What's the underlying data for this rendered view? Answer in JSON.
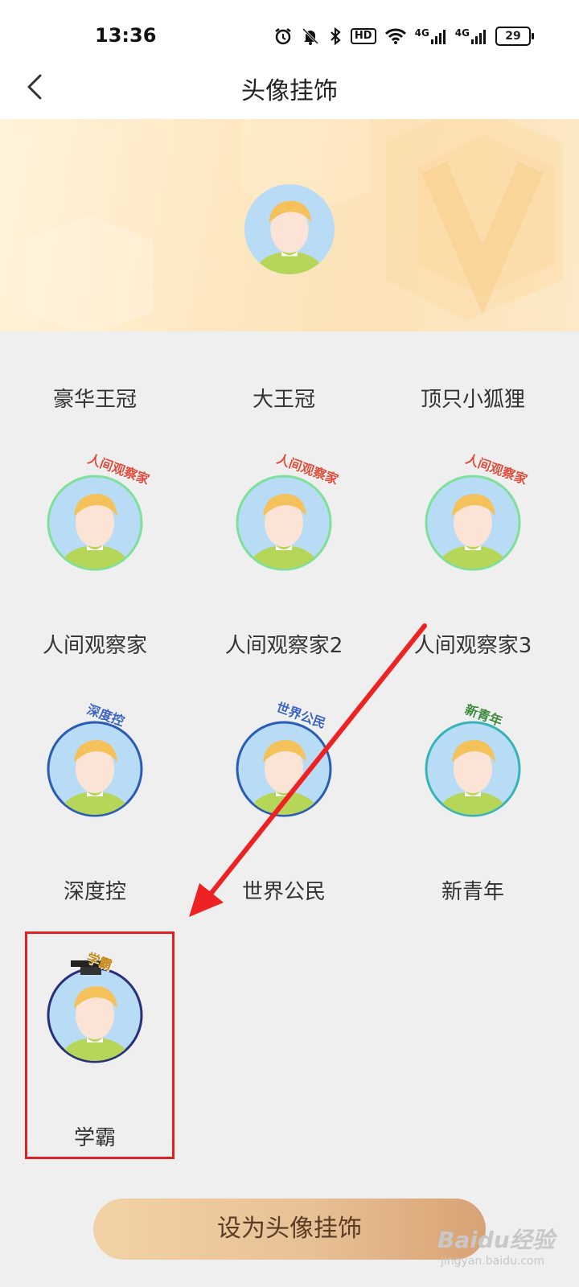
{
  "status": {
    "time": "13:36",
    "battery": "29",
    "network1": "4G",
    "network2": "4G",
    "hd": "HD"
  },
  "header": {
    "title": "头像挂饰",
    "back_icon": "chevron-left-icon"
  },
  "row0_labels": [
    "豪华王冠",
    "大王冠",
    "顶只小狐狸"
  ],
  "grid": [
    {
      "label": "人间观察家",
      "badge_text": "人间观察家"
    },
    {
      "label": "人间观察家2",
      "badge_text": "人间观察家"
    },
    {
      "label": "人间观察家3",
      "badge_text": "人间观察家"
    },
    {
      "label": "深度控",
      "badge_text": "深度控"
    },
    {
      "label": "世界公民",
      "badge_text": "世界公民"
    },
    {
      "label": "新青年",
      "badge_text": "新青年"
    },
    {
      "label": "学霸",
      "badge_text": "学霸"
    }
  ],
  "selected_index": 6,
  "button": {
    "label": "设为头像挂饰"
  },
  "watermark": {
    "brand": "Baidu经验",
    "url": "jingyan.baidu.com"
  },
  "colors": {
    "accent_red": "#e02020",
    "button_gradient_start": "#f2d2a6",
    "button_gradient_end": "#d8a274",
    "avatar_bg": "#b9dcf6"
  }
}
